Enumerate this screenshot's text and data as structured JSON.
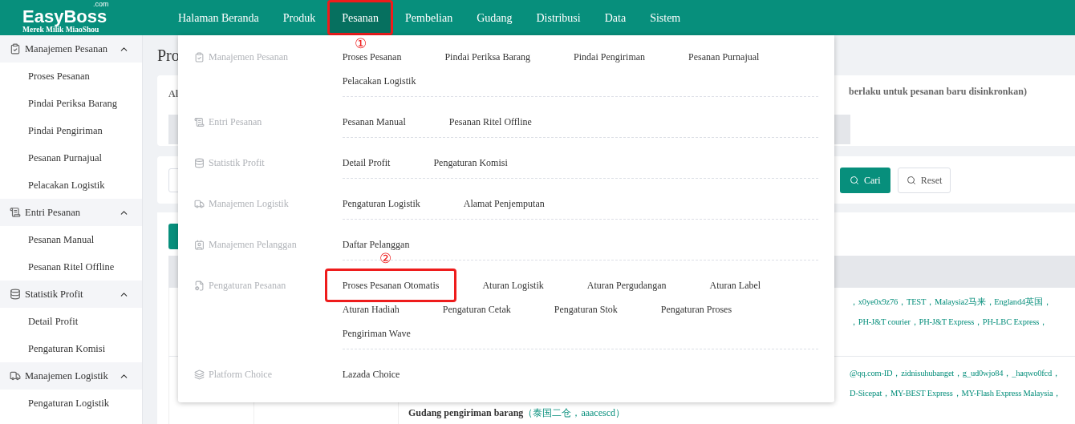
{
  "logo": {
    "name": "EasyBoss",
    "suffix": ".com",
    "tagline": "Merek Milik MiaoShou"
  },
  "nav": [
    {
      "label": "Halaman Beranda",
      "selected": false,
      "highlighted": false
    },
    {
      "label": "Produk",
      "selected": false,
      "highlighted": false
    },
    {
      "label": "Pesanan",
      "selected": true,
      "highlighted": true,
      "marker": "①"
    },
    {
      "label": "Pembelian",
      "selected": false,
      "highlighted": false
    },
    {
      "label": "Gudang",
      "selected": false,
      "highlighted": false
    },
    {
      "label": "Distribusi",
      "selected": false,
      "highlighted": false
    },
    {
      "label": "Data",
      "selected": false,
      "highlighted": false
    },
    {
      "label": "Sistem",
      "selected": false,
      "highlighted": false
    }
  ],
  "sidebar": {
    "groups": [
      {
        "label": "Manajemen Pesanan",
        "expanded": true,
        "items": [
          "Proses Pesanan",
          "Pindai Periksa Barang",
          "Pindai Pengiriman",
          "Pesanan Purnajual",
          "Pelacakan Logistik"
        ]
      },
      {
        "label": "Entri Pesanan",
        "expanded": true,
        "items": [
          "Pesanan Manual",
          "Pesanan Ritel Offline"
        ]
      },
      {
        "label": "Statistik Profit",
        "expanded": true,
        "items": [
          "Detail Profit",
          "Pengaturan Komisi"
        ]
      },
      {
        "label": "Manajemen Logistik",
        "expanded": true,
        "items": [
          "Pengaturan Logistik"
        ]
      }
    ]
  },
  "page": {
    "title": "Pro",
    "notice_start": "Al",
    "notice_end": "berlaku untuk pesanan baru disinkronkan)",
    "search_button": "Cari",
    "reset_button": "Reset",
    "rows": [
      {
        "lines": [
          "，x0ye0x9z76，TEST，Malaysia2马来，England4英国，",
          "，PH-J&T courier，PH-J&T Express，PH-LBC Express，"
        ]
      },
      {
        "lines": [
          "@qq.com-ID，zidnisuhubanget，g_ud0wjo84，_haqwo0fcd，",
          "D-Sicepat，MY-BEST Express，MY-Flash Express Malaysia，"
        ],
        "warehouse_label": "Gudang pengiriman barang",
        "warehouse_value": "（泰国二仓，aaacescd）"
      }
    ]
  },
  "menu": {
    "sections": [
      {
        "label": "Manajemen Pesanan",
        "items": [
          {
            "label": "Proses Pesanan",
            "highlighted": false
          },
          {
            "label": "Pindai Periksa Barang",
            "highlighted": false
          },
          {
            "label": "Pindai Pengiriman",
            "highlighted": false
          },
          {
            "label": "Pesanan Purnajual",
            "highlighted": false
          },
          {
            "label": "Pelacakan Logistik",
            "highlighted": false
          }
        ]
      },
      {
        "label": "Entri Pesanan",
        "items": [
          {
            "label": "Pesanan Manual",
            "highlighted": false
          },
          {
            "label": "Pesanan Ritel Offline",
            "highlighted": false
          }
        ]
      },
      {
        "label": "Statistik Profit",
        "items": [
          {
            "label": "Detail Profit",
            "highlighted": false
          },
          {
            "label": "Pengaturan Komisi",
            "highlighted": false
          }
        ]
      },
      {
        "label": "Manajemen Logistik",
        "items": [
          {
            "label": "Pengaturan Logistik",
            "highlighted": false
          },
          {
            "label": "Alamat Penjemputan",
            "highlighted": false
          }
        ]
      },
      {
        "label": "Manajemen Pelanggan",
        "items": [
          {
            "label": "Daftar Pelanggan",
            "highlighted": false
          }
        ]
      },
      {
        "label": "Pengaturan Pesanan",
        "items": [
          {
            "label": "Proses Pesanan Otomatis",
            "highlighted": true,
            "marker": "②"
          },
          {
            "label": "Aturan Logistik",
            "highlighted": false
          },
          {
            "label": "Aturan Pergudangan",
            "highlighted": false
          },
          {
            "label": "Aturan Label",
            "highlighted": false
          },
          {
            "label": "Aturan Hadiah",
            "highlighted": false
          },
          {
            "label": "Pengaturan Cetak",
            "highlighted": false
          },
          {
            "label": "Pengaturan Stok",
            "highlighted": false
          },
          {
            "label": "Pengaturan Proses",
            "highlighted": false
          },
          {
            "label": "Pengiriman Wave",
            "highlighted": false
          }
        ]
      },
      {
        "label": "Platform Choice",
        "items": [
          {
            "label": "Lazada Choice",
            "highlighted": false
          }
        ]
      }
    ]
  }
}
